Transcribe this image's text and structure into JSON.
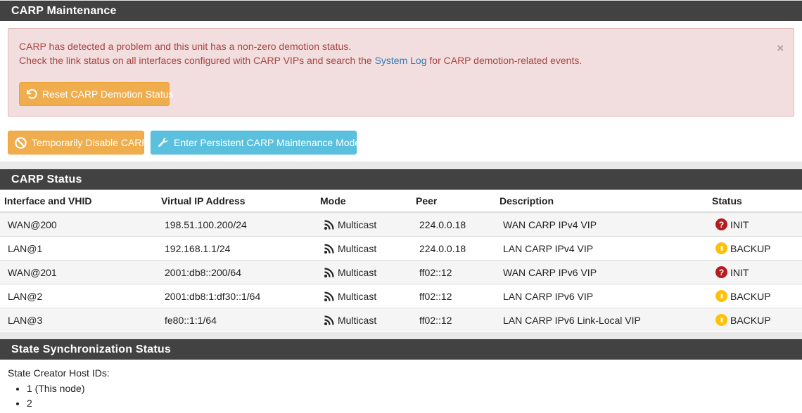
{
  "maintenance": {
    "heading": "CARP Maintenance",
    "alert": {
      "line1": "CARP has detected a problem and this unit has a non-zero demotion status.",
      "line2_before": "Check the link status on all interfaces configured with CARP VIPs and search the",
      "line2_link": "System Log",
      "line2_after": "for CARP demotion-related events.",
      "close": "×",
      "reset_button": "Reset CARP Demotion Status"
    },
    "disable_button": "Temporarily Disable CARP",
    "maintenance_button": "Enter Persistent CARP Maintenance Mode"
  },
  "carp_status": {
    "heading": "CARP Status",
    "columns": [
      "Interface and VHID",
      "Virtual IP Address",
      "Mode",
      "Peer",
      "Description",
      "Status"
    ],
    "rows": [
      {
        "iface": "WAN@200",
        "vip": "198.51.100.200/24",
        "mode": "Multicast",
        "peer": "224.0.0.18",
        "desc": "WAN CARP IPv4 VIP",
        "status": "INIT",
        "status_glyph": "?"
      },
      {
        "iface": "LAN@1",
        "vip": "192.168.1.1/24",
        "mode": "Multicast",
        "peer": "224.0.0.18",
        "desc": "LAN CARP IPv4 VIP",
        "status": "BACKUP",
        "status_glyph": "II"
      },
      {
        "iface": "WAN@201",
        "vip": "2001:db8::200/64",
        "mode": "Multicast",
        "peer": "ff02::12",
        "desc": "WAN CARP IPv6 VIP",
        "status": "INIT",
        "status_glyph": "?"
      },
      {
        "iface": "LAN@2",
        "vip": "2001:db8:1:df30::1/64",
        "mode": "Multicast",
        "peer": "ff02::12",
        "desc": "LAN CARP IPv6 VIP",
        "status": "BACKUP",
        "status_glyph": "II"
      },
      {
        "iface": "LAN@3",
        "vip": "fe80::1:1/64",
        "mode": "Multicast",
        "peer": "ff02::12",
        "desc": "LAN CARP IPv6 Link-Local VIP",
        "status": "BACKUP",
        "status_glyph": "II"
      }
    ]
  },
  "sync": {
    "heading": "State Synchronization Status",
    "label": "State Creator Host IDs:",
    "ids": [
      "1 (This node)",
      "2"
    ]
  },
  "colors": {
    "heading_bg": "#424242",
    "alert_bg": "#f2dede",
    "warning": "#f0ad4e",
    "info": "#5bc0de",
    "init": "#b71c1c",
    "backup": "#ffc107"
  }
}
